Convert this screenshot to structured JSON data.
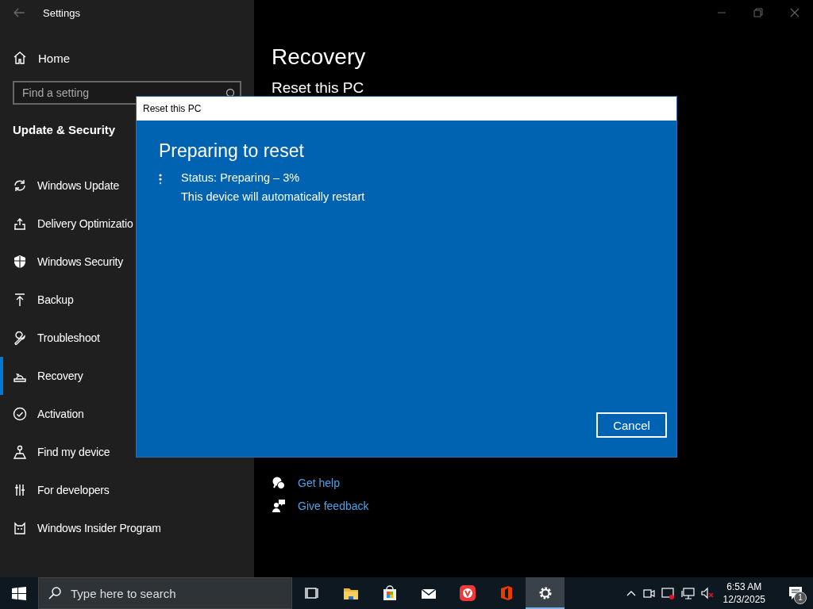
{
  "window": {
    "title": "Settings"
  },
  "sidebar": {
    "home": "Home",
    "search": {
      "placeholder": "Find a setting"
    },
    "section": "Update & Security",
    "items": [
      {
        "label": "Windows Update",
        "selected": false
      },
      {
        "label": "Delivery Optimizatio",
        "selected": false
      },
      {
        "label": "Windows Security",
        "selected": false
      },
      {
        "label": "Backup",
        "selected": false
      },
      {
        "label": "Troubleshoot",
        "selected": false
      },
      {
        "label": "Recovery",
        "selected": true
      },
      {
        "label": "Activation",
        "selected": false
      },
      {
        "label": "Find my device",
        "selected": false
      },
      {
        "label": "For developers",
        "selected": false
      },
      {
        "label": "Windows Insider Program",
        "selected": false
      }
    ]
  },
  "main": {
    "title": "Recovery",
    "subtitle": "Reset this PC",
    "links": [
      "Get help",
      "Give feedback"
    ]
  },
  "dialog": {
    "title": "Reset this PC",
    "heading": "Preparing to reset",
    "status": "Status: Preparing – 3%",
    "note": "This device will automatically restart",
    "button": "Cancel"
  },
  "taskbar": {
    "search": {
      "placeholder": "Type here to search"
    },
    "apps": [
      {
        "kind": "taskview",
        "selected": false
      },
      {
        "kind": "explorer",
        "selected": false
      },
      {
        "kind": "store",
        "selected": false
      },
      {
        "kind": "mail",
        "selected": false
      },
      {
        "kind": "vivaldi",
        "selected": false
      },
      {
        "kind": "office",
        "selected": false
      },
      {
        "kind": "settings",
        "selected": true
      }
    ],
    "time": "6:53 AM",
    "date": "12/3/2025",
    "notifications": "1"
  }
}
